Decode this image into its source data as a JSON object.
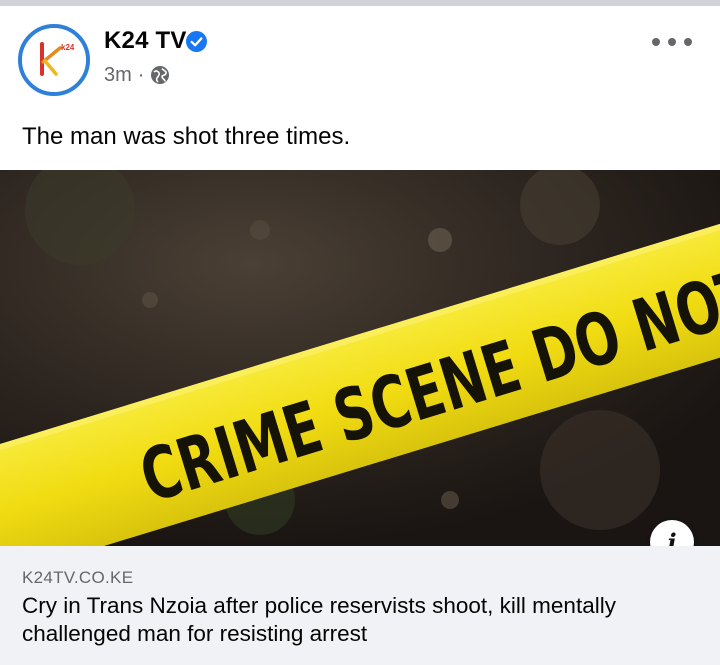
{
  "post": {
    "page_name": "K24 TV",
    "time": "3m",
    "separator": "·",
    "audience_icon": "globe-icon",
    "verified_icon": "verified-badge-icon",
    "more_icon": "more-options-icon",
    "avatar_text": "k24",
    "text": "The man was shot three times."
  },
  "media": {
    "tape_text": "CRIME SCENE DO NOT CROSS",
    "info_icon": "info-icon",
    "info_label": "i"
  },
  "link": {
    "domain": "K24TV.CO.KE",
    "headline": "Cry in Trans Nzoia after police reservists shoot, kill mentally challenged man for resisting arrest"
  },
  "colors": {
    "verified_blue": "#1877f2",
    "avatar_ring": "#2f80d8",
    "tape_yellow": "#f4e21a",
    "link_card_bg": "#f0f2f5",
    "secondary_text": "#65676b"
  }
}
